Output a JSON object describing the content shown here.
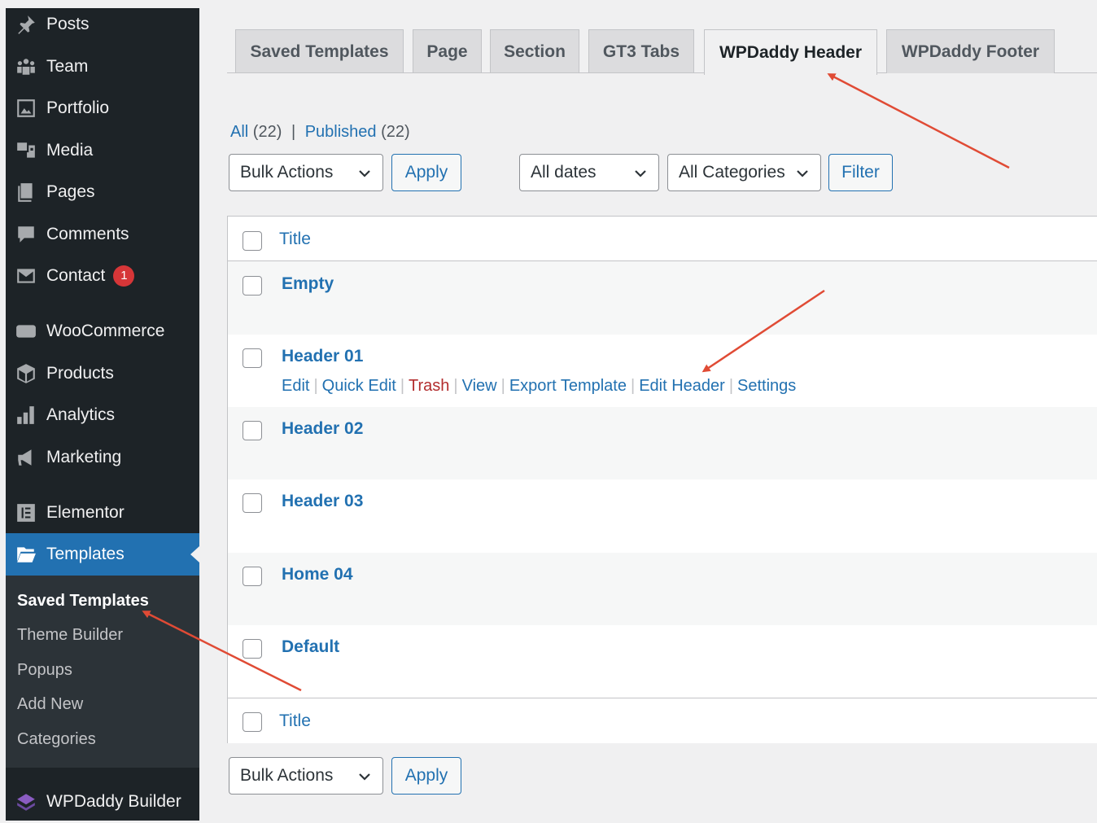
{
  "sidebar": {
    "items": [
      {
        "icon": "pushpin-icon",
        "label": "Posts"
      },
      {
        "icon": "team-icon",
        "label": "Team"
      },
      {
        "icon": "portfolio-icon",
        "label": "Portfolio"
      },
      {
        "icon": "media-icon",
        "label": "Media"
      },
      {
        "icon": "pages-icon",
        "label": "Pages"
      },
      {
        "icon": "comments-icon",
        "label": "Comments"
      },
      {
        "icon": "envelope-icon",
        "label": "Contact",
        "badge": "1"
      },
      {
        "icon": "woo-icon",
        "label": "WooCommerce"
      },
      {
        "icon": "products-icon",
        "label": "Products"
      },
      {
        "icon": "analytics-icon",
        "label": "Analytics"
      },
      {
        "icon": "megaphone-icon",
        "label": "Marketing"
      },
      {
        "icon": "elementor-icon",
        "label": "Elementor"
      },
      {
        "icon": "folder-icon",
        "label": "Templates"
      },
      {
        "icon": "layers-icon",
        "label": "WPDaddy Builder"
      }
    ],
    "submenu": [
      "Saved Templates",
      "Theme Builder",
      "Popups",
      "Add New",
      "Categories"
    ]
  },
  "tabs": [
    "Saved Templates",
    "Page",
    "Section",
    "GT3 Tabs",
    "WPDaddy Header",
    "WPDaddy Footer"
  ],
  "filters": {
    "all_label": "All",
    "all_count": "(22)",
    "divider": "|",
    "published_label": "Published",
    "published_count": "(22)",
    "bulk_actions": "Bulk Actions",
    "apply": "Apply",
    "all_dates": "All dates",
    "all_categories": "All Categories",
    "filter": "Filter"
  },
  "table": {
    "column_title": "Title",
    "rows": [
      "Empty",
      "Header 01",
      "Header 02",
      "Header 03",
      "Home 04",
      "Default"
    ],
    "row_actions": [
      "Edit",
      "Quick Edit",
      "Trash",
      "View",
      "Export Template",
      "Edit Header",
      "Settings"
    ]
  },
  "colors": {
    "sidebar_bg": "#1d2327",
    "accent": "#2271b1",
    "arrow": "#e04b35",
    "trash": "#b32d2e"
  }
}
